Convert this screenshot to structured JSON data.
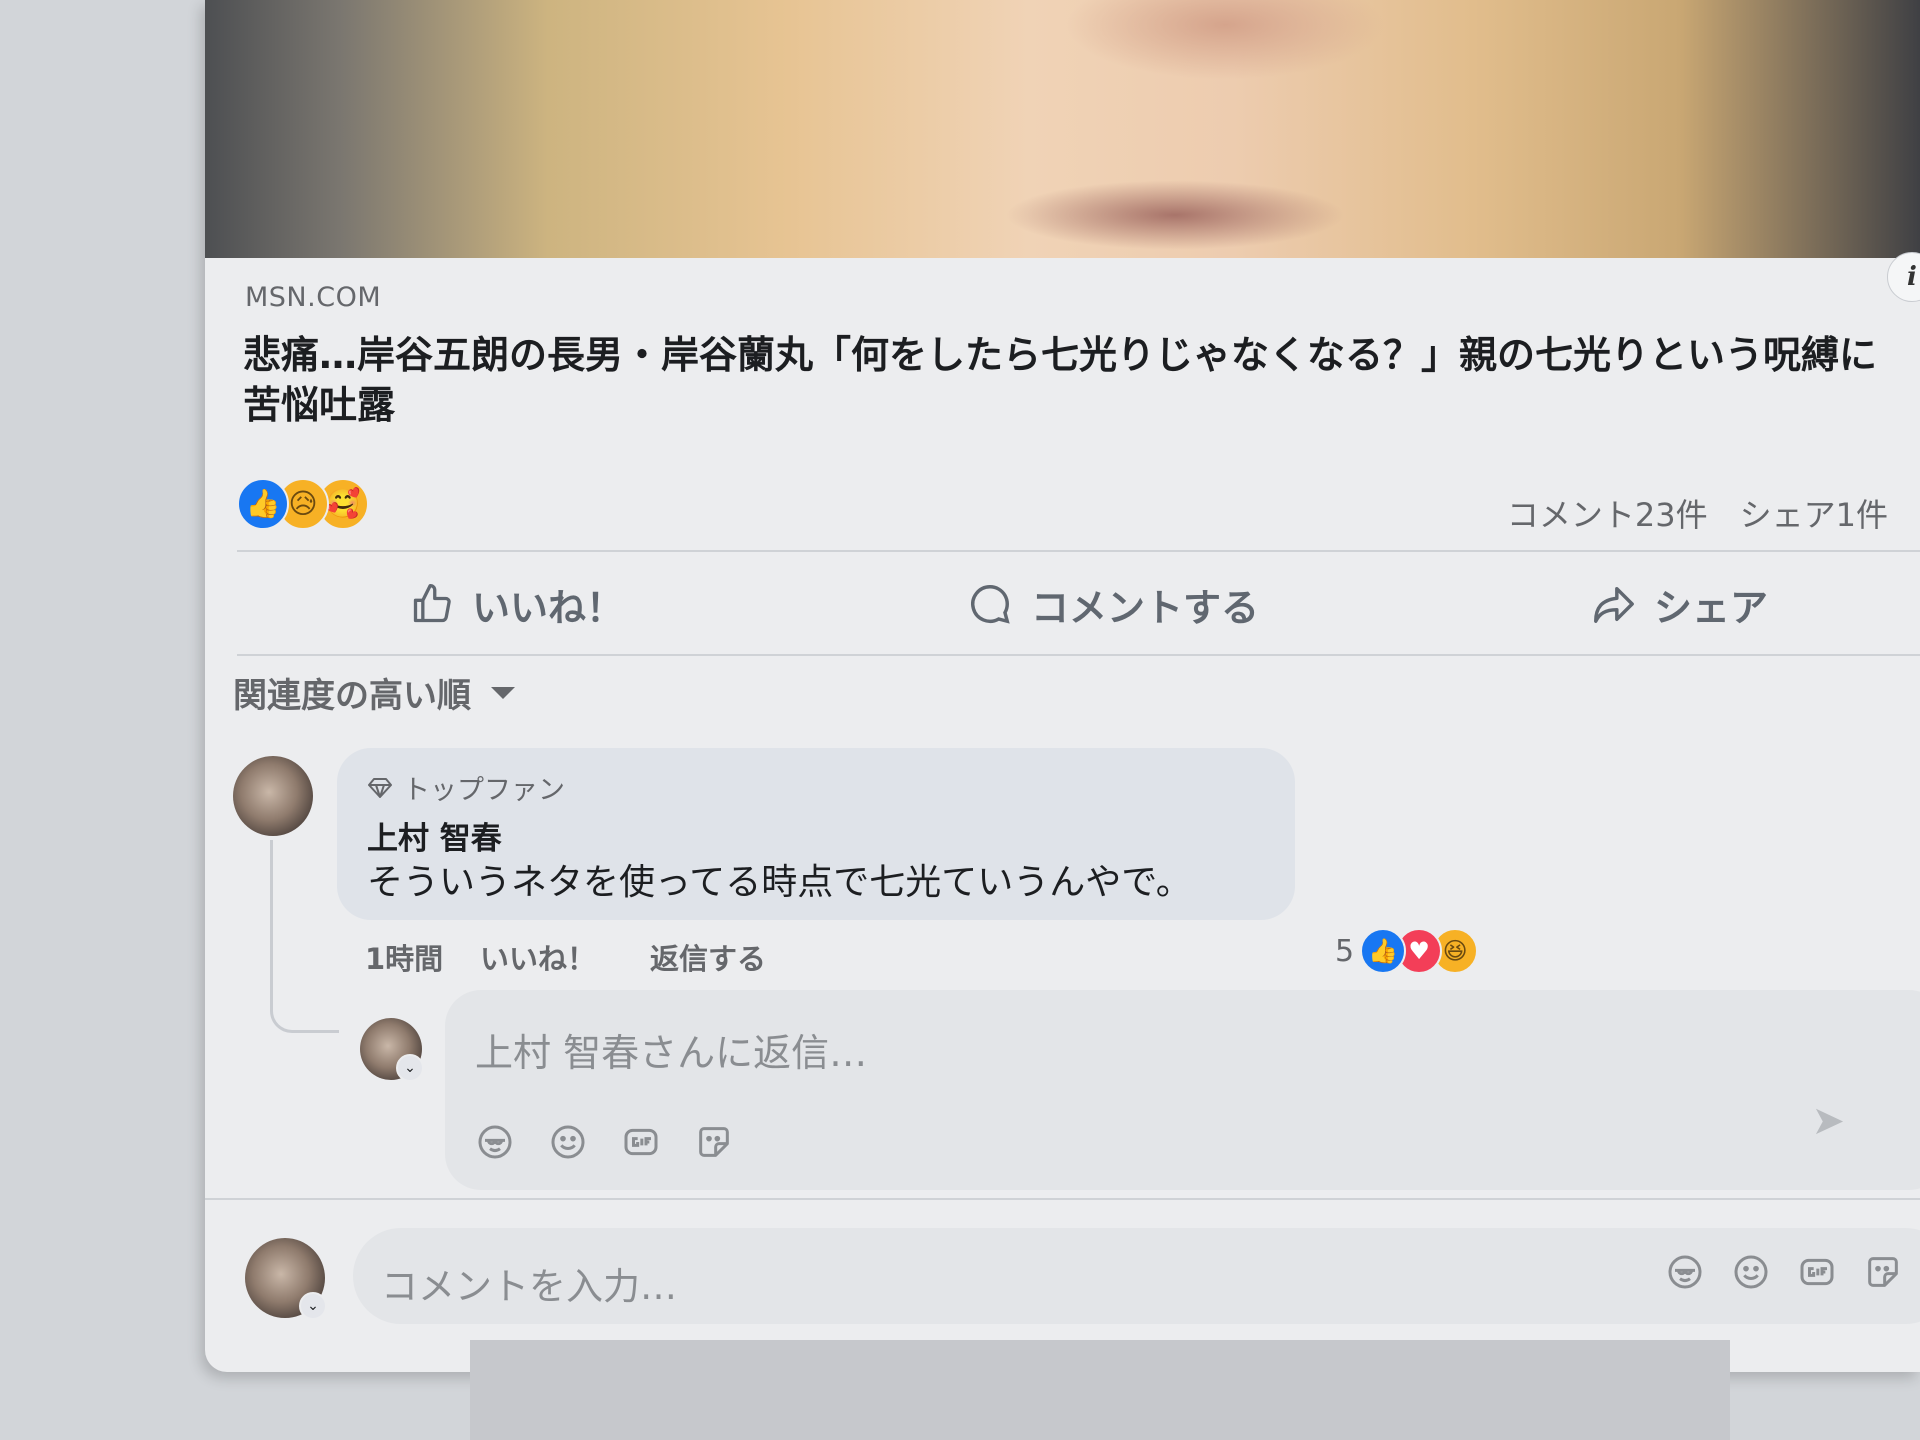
{
  "post": {
    "source": "MSN.COM",
    "headline": "悲痛…岸谷五朗の長男・岸谷蘭丸「何をしたら七光りじゃなくなる？」親の七光りという呪縛に苦悩吐露",
    "info_icon": "i",
    "reactions": [
      "like",
      "sad",
      "care"
    ],
    "comment_count": "コメント23件",
    "share_count": "シェア1件"
  },
  "actions": {
    "like": "いいね！",
    "comment": "コメントする",
    "share": "シェア"
  },
  "sort": {
    "label": "関連度の高い順"
  },
  "comment": {
    "badge": "トップファン",
    "author": "上村 智春",
    "text": "そういうネタを使ってる時点で七光ていうんやで。",
    "time": "1時間",
    "like": "いいね！",
    "reply": "返信する",
    "reaction_count": "5",
    "reactions": [
      "like",
      "love",
      "haha"
    ]
  },
  "reply_box": {
    "placeholder": "上村 智春さんに返信…",
    "tools": [
      "avatar-sticker-icon",
      "emoji-icon",
      "gif-icon",
      "sticker-icon"
    ]
  },
  "comment_box": {
    "placeholder": "コメントを入力…",
    "tools": [
      "avatar-sticker-icon",
      "emoji-icon",
      "gif-icon",
      "sticker-icon"
    ]
  },
  "colors": {
    "accent": "#1877f2",
    "love": "#f33e58",
    "emoji_yellow": "#f7b125"
  }
}
